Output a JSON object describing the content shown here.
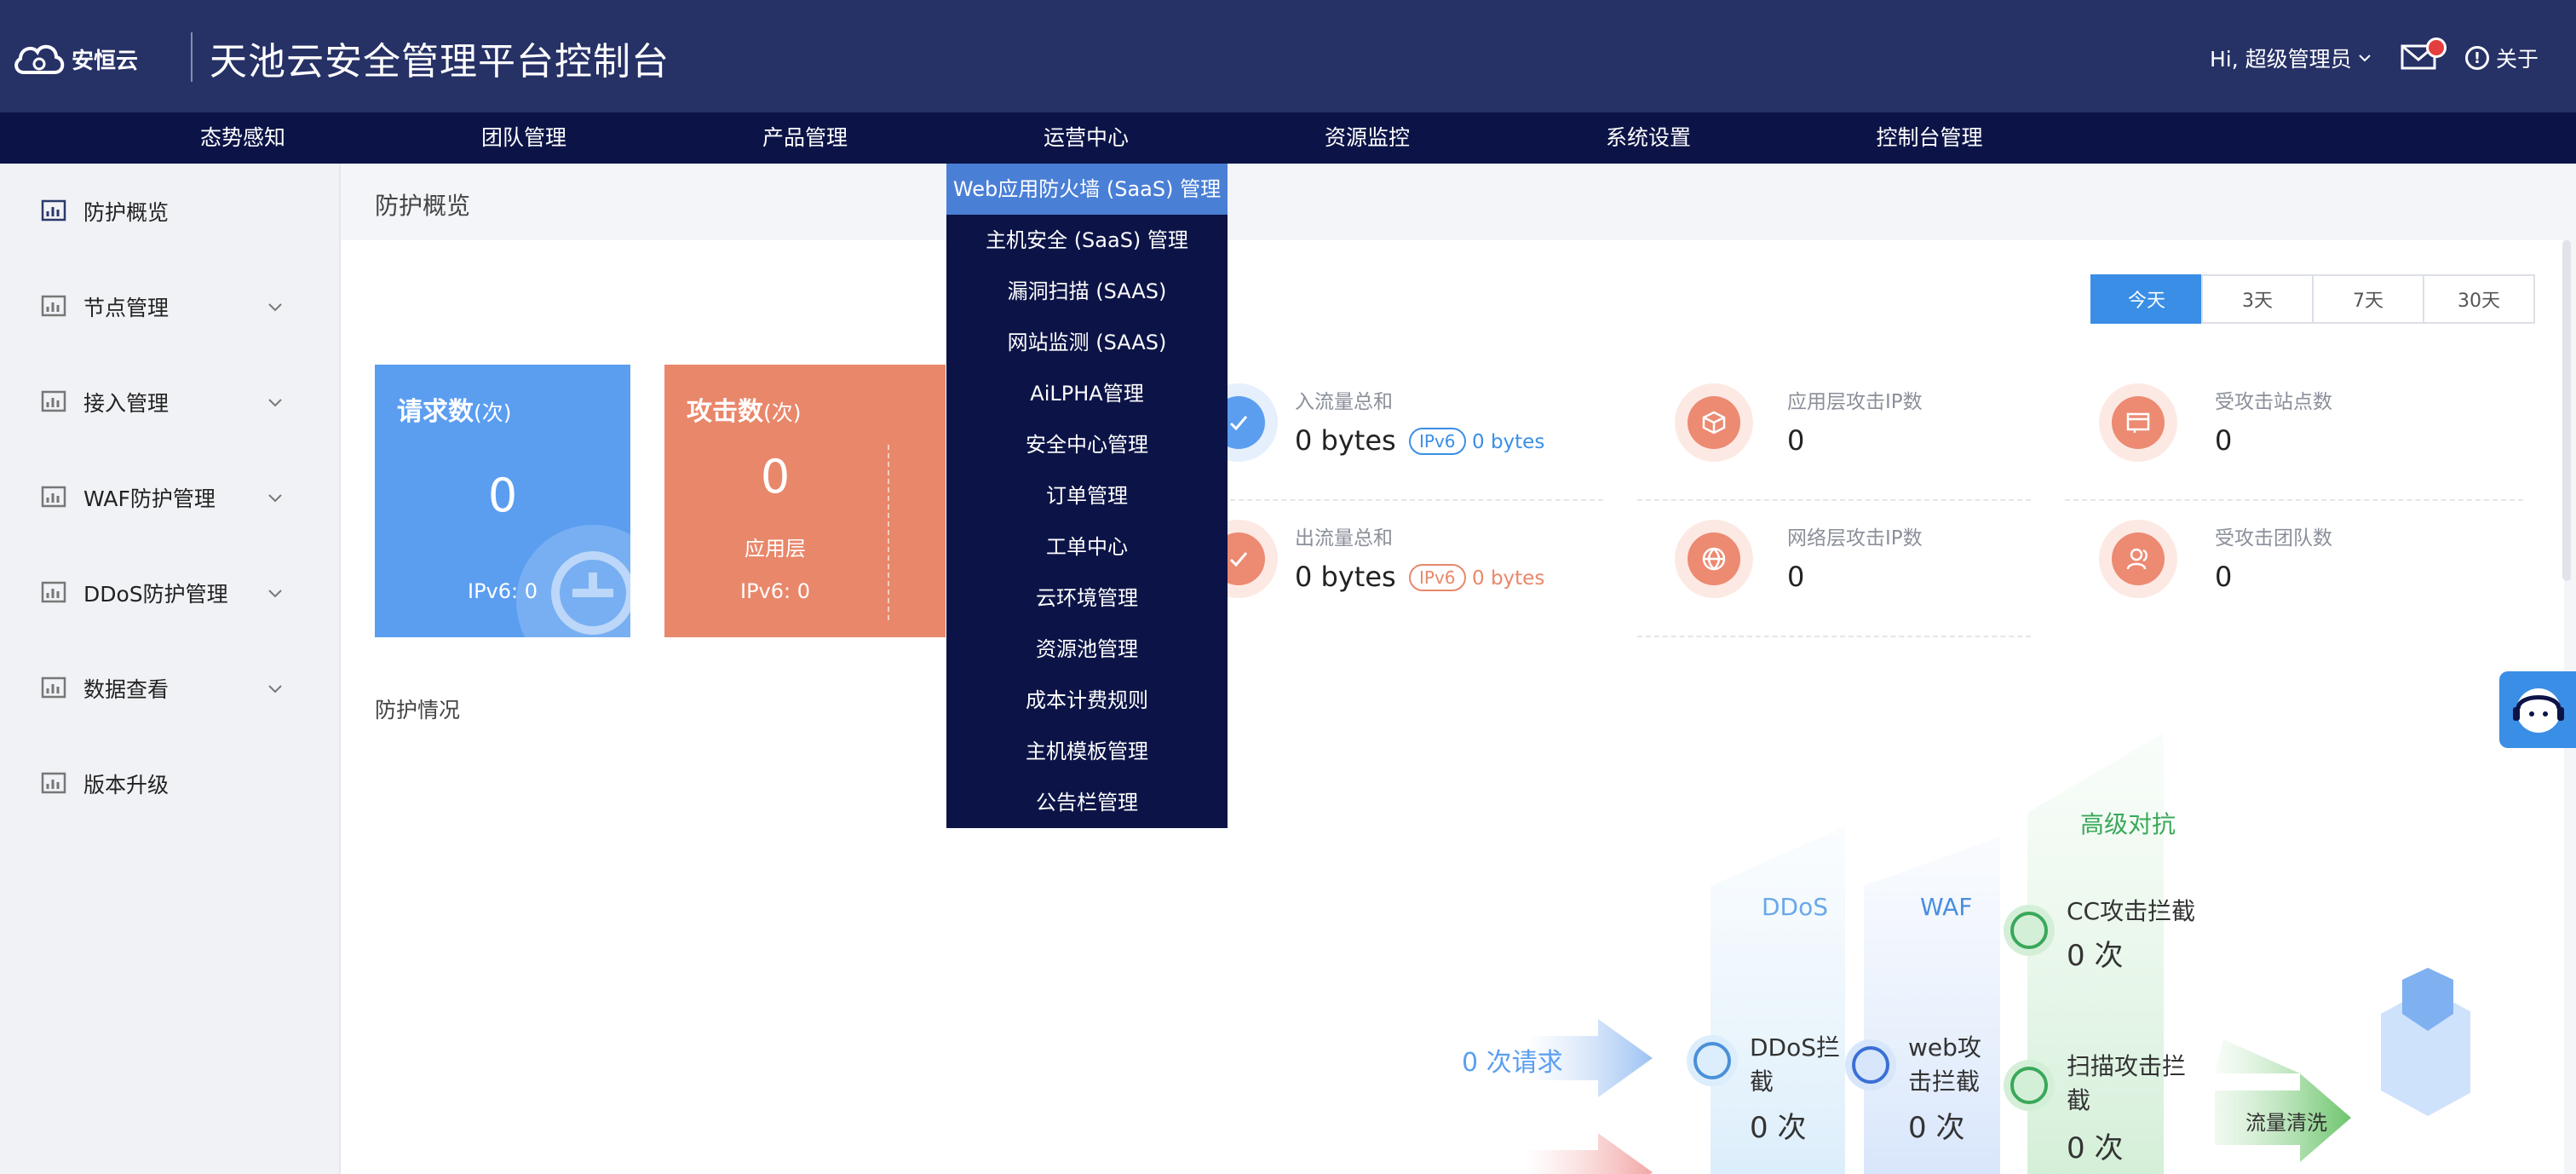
{
  "header": {
    "logo_text": "安恒云",
    "app_title": "天池云安全管理平台控制台",
    "user_greeting": "Hi, 超级管理员",
    "about_label": "关于",
    "colors": {
      "bg": "#263166",
      "nav_bg": "#0c1447",
      "notify_dot": "#e53e3e"
    }
  },
  "nav": {
    "items": [
      "态势感知",
      "团队管理",
      "产品管理",
      "运营中心",
      "资源监控",
      "系统设置",
      "控制台管理"
    ]
  },
  "sidebar": {
    "items": [
      {
        "label": "防护概览",
        "icon": "chart-icon",
        "expandable": false
      },
      {
        "label": "节点管理",
        "icon": "chart-icon",
        "expandable": true
      },
      {
        "label": "接入管理",
        "icon": "chart-icon",
        "expandable": true
      },
      {
        "label": "WAF防护管理",
        "icon": "chart-icon",
        "expandable": true
      },
      {
        "label": "DDoS防护管理",
        "icon": "chart-icon",
        "expandable": true
      },
      {
        "label": "数据查看",
        "icon": "chart-icon",
        "expandable": true
      },
      {
        "label": "版本升级",
        "icon": "chart-icon",
        "expandable": false
      }
    ]
  },
  "breadcrumb": "防护概览",
  "range": {
    "options": [
      "今天",
      "3天",
      "7天",
      "30天"
    ],
    "selected": "今天"
  },
  "cards": {
    "requests": {
      "title": "请求数",
      "unit": "(次)",
      "value": "0",
      "ipv6": "IPv6: 0",
      "color": "#5b9ef0"
    },
    "attacks": {
      "title": "攻击数",
      "unit": "(次)",
      "value": "0",
      "layer": "应用层",
      "ipv6": "IPv6: 0",
      "color": "#e9876a"
    }
  },
  "stats": {
    "inbound": {
      "label": "入流量总和",
      "value": "0 bytes",
      "ipv6_tag": "IPv6",
      "ipv6_value": "0 bytes"
    },
    "outbound": {
      "label": "出流量总和",
      "value": "0 bytes",
      "ipv6_tag": "IPv6",
      "ipv6_value": "0 bytes"
    },
    "app_attack_ip": {
      "label": "应用层攻击IP数",
      "value": "0"
    },
    "net_attack_ip": {
      "label": "网络层攻击IP数",
      "value": "0"
    },
    "attacked_sites": {
      "label": "受攻击站点数",
      "value": "0"
    },
    "attacked_teams": {
      "label": "受攻击团队数",
      "value": "0"
    }
  },
  "section_title": "防护情况",
  "dropdown": {
    "items": [
      "Web应用防火墙 (SaaS) 管理",
      "主机安全 (SaaS) 管理",
      "漏洞扫描 (SAAS)",
      "网站监测 (SAAS)",
      "AiLPHA管理",
      "安全中心管理",
      "订单管理",
      "工单中心",
      "云环境管理",
      "资源池管理",
      "成本计费规则",
      "主机模板管理",
      "公告栏管理"
    ],
    "active_index": 0
  },
  "diagram": {
    "requests_label": "0 次请求",
    "ddos_column": "DDoS",
    "waf_column": "WAF",
    "advanced_column": "高级对抗",
    "ddos_block_label": "DDoS拦截",
    "ddos_block_value": "0 次",
    "web_block_label": "web攻击拦截",
    "web_block_value": "0 次",
    "cc_block_label": "CC攻击拦截",
    "cc_block_value": "0 次",
    "scan_block_label": "扫描攻击拦截",
    "scan_block_value": "0 次",
    "clean_label": "流量清洗"
  }
}
